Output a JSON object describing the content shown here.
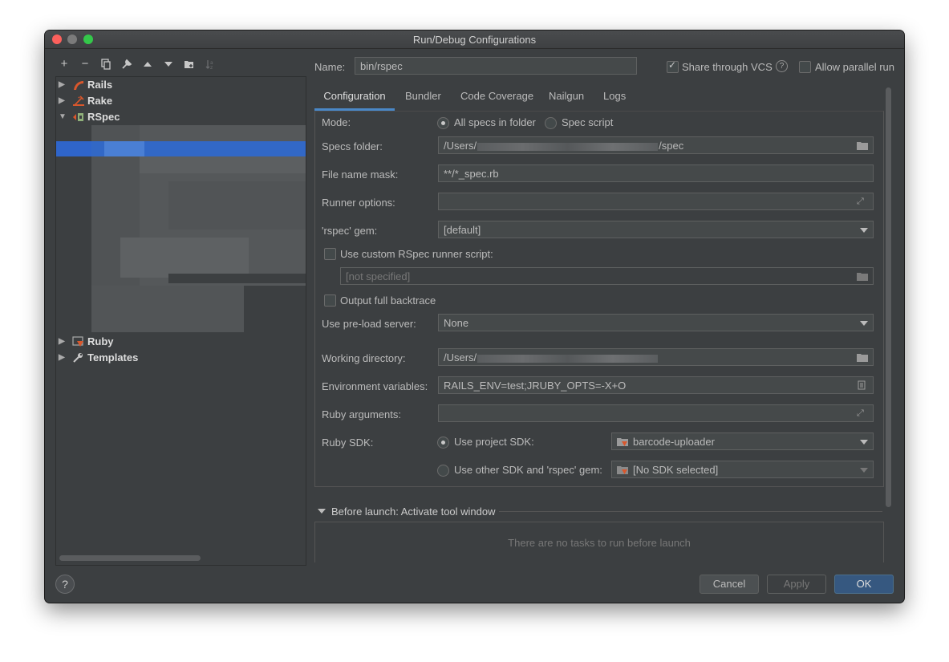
{
  "window": {
    "title": "Run/Debug Configurations"
  },
  "toolbar": {
    "add": "+",
    "remove": "−",
    "copy_icon": "copy-icon",
    "wrench_icon": "wrench-icon",
    "up_icon": "arrow-up-icon",
    "down_icon": "arrow-down-icon",
    "folder_icon": "new-folder-icon",
    "sort_icon": "sort-icon"
  },
  "tree": {
    "items": [
      {
        "label": "Rails",
        "expanded": false,
        "icon": "rails-icon"
      },
      {
        "label": "Rake",
        "expanded": false,
        "icon": "rake-icon"
      },
      {
        "label": "RSpec",
        "expanded": true,
        "icon": "rspec-icon"
      },
      {
        "label": "Ruby",
        "expanded": false,
        "icon": "ruby-icon"
      },
      {
        "label": "Templates",
        "expanded": false,
        "icon": "wrench-icon"
      }
    ]
  },
  "name_row": {
    "label": "Name:",
    "value": "bin/rspec",
    "share_label": "Share through VCS",
    "share_checked": true,
    "help": "?",
    "parallel_label": "Allow parallel run",
    "parallel_checked": false
  },
  "tabs": [
    "Configuration",
    "Bundler",
    "Code Coverage",
    "Nailgun",
    "Logs"
  ],
  "form": {
    "mode_label": "Mode:",
    "mode_option1": "All specs in folder",
    "mode_option2": "Spec script",
    "specs_folder_label": "Specs folder:",
    "specs_folder_prefix": "/Users/",
    "specs_folder_suffix": "/spec",
    "file_mask_label": "File name mask:",
    "file_mask_value": "**/*_spec.rb",
    "runner_options_label": "Runner options:",
    "runner_options_value": "",
    "rspec_gem_label": "'rspec' gem:",
    "rspec_gem_value": "[default]",
    "custom_runner_label": "Use custom RSpec runner script:",
    "custom_runner_value": "[not specified]",
    "backtrace_label": "Output full backtrace",
    "preload_label": "Use pre-load server:",
    "preload_value": "None",
    "working_dir_label": "Working directory:",
    "working_dir_prefix": "/Users/",
    "env_label": "Environment variables:",
    "env_value": "RAILS_ENV=test;JRUBY_OPTS=-X+O",
    "ruby_args_label": "Ruby arguments:",
    "ruby_args_value": "",
    "ruby_sdk_label": "Ruby SDK:",
    "use_project_sdk": "Use project SDK:",
    "project_sdk_value": "barcode-uploader",
    "use_other_sdk": "Use other SDK and 'rspec' gem:",
    "other_sdk_value": "[No SDK selected]"
  },
  "before_launch": {
    "label": "Before launch: Activate tool window",
    "empty_text": "There are no tasks to run before launch"
  },
  "buttons": {
    "help": "?",
    "cancel": "Cancel",
    "apply": "Apply",
    "ok": "OK"
  },
  "colors": {
    "background": "#3c3f41",
    "selection": "#2f65ca",
    "accent_tab": "#4a88c7",
    "ok_button": "#365880",
    "close": "#fc605c",
    "zoom": "#34c84a"
  }
}
